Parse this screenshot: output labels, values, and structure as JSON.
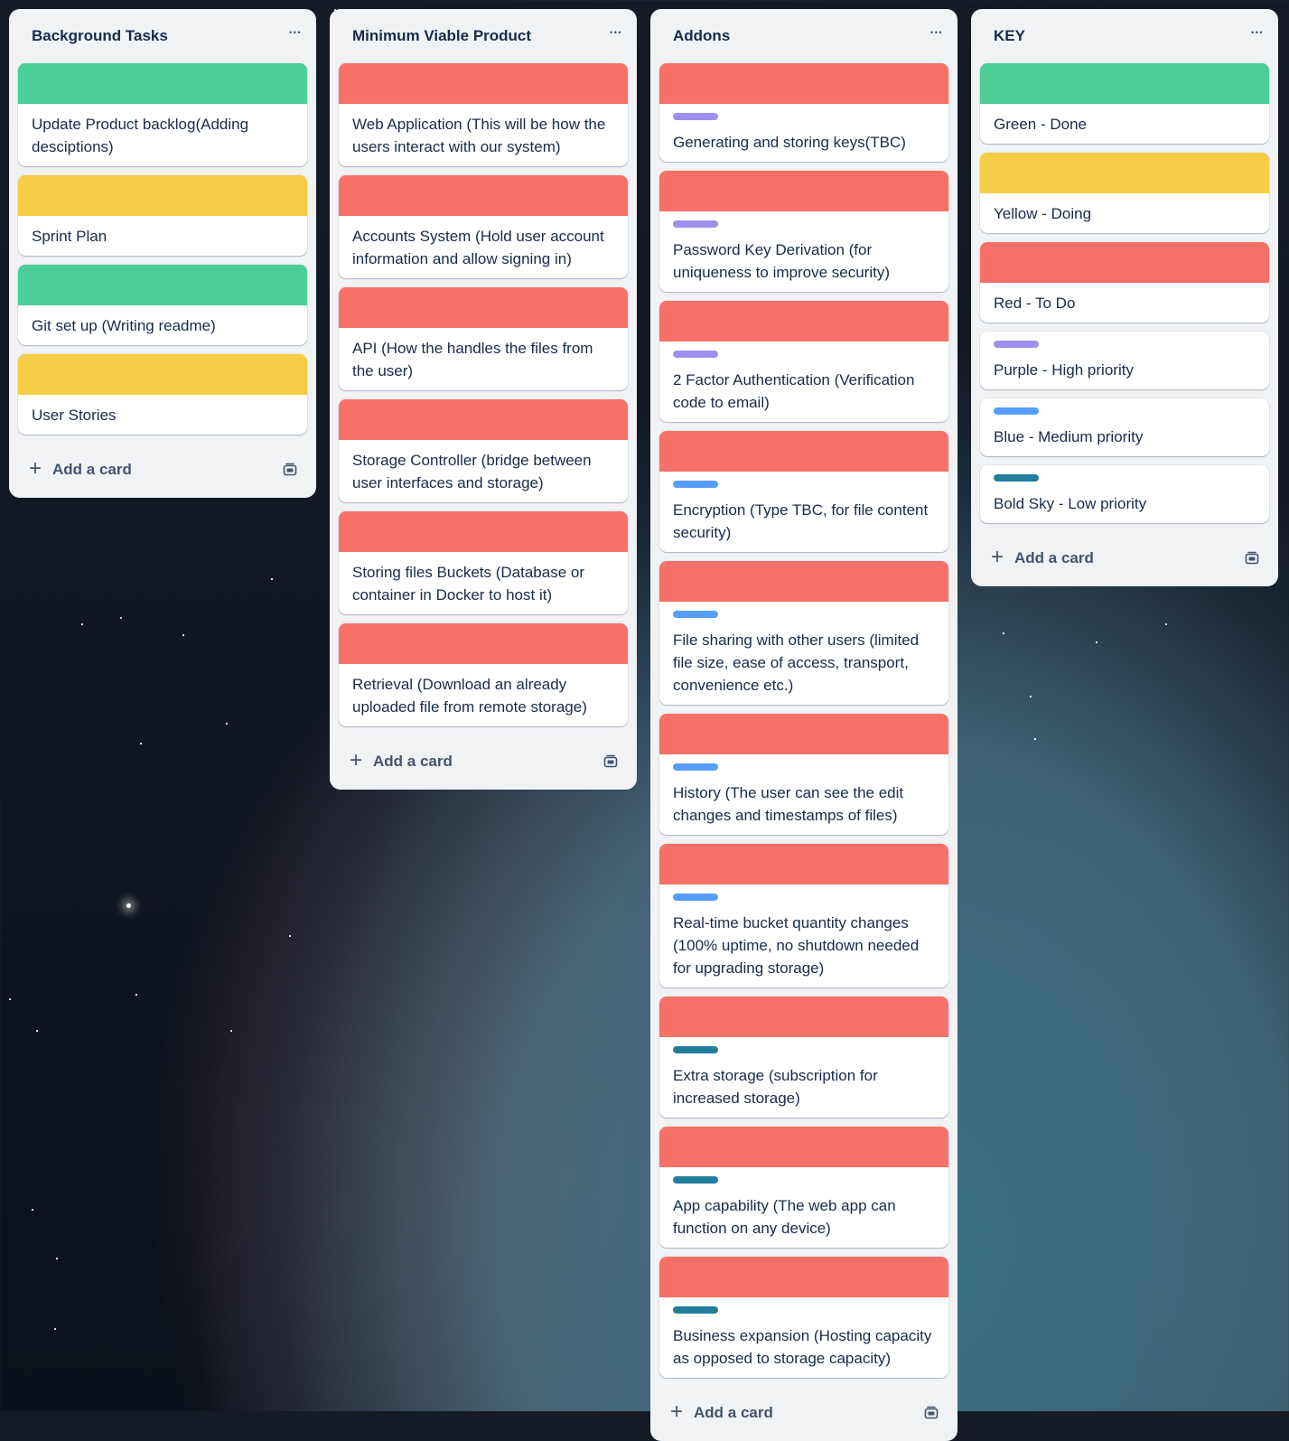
{
  "colors": {
    "green": "#4bce97",
    "yellow": "#f5cd47",
    "red": "#f87168",
    "purple": "#9f8fef",
    "blue": "#579dff",
    "bold_sky": "#227d9b"
  },
  "lists": [
    {
      "title": "Background Tasks",
      "menu_icon": "more-icon",
      "add_card_label": "Add a card",
      "cards": [
        {
          "cover": "green",
          "label": null,
          "title": "Update Product backlog(Adding desciptions)"
        },
        {
          "cover": "yellow",
          "label": null,
          "title": "Sprint Plan"
        },
        {
          "cover": "green",
          "label": null,
          "title": "Git set up (Writing readme)"
        },
        {
          "cover": "yellow",
          "label": null,
          "title": "User Stories"
        }
      ]
    },
    {
      "title": "Minimum Viable Product",
      "menu_icon": "more-icon",
      "add_card_label": "Add a card",
      "cards": [
        {
          "cover": "red",
          "label": null,
          "title": "Web Application (This will be how the users interact with our system)"
        },
        {
          "cover": "red",
          "label": null,
          "title": "Accounts System (Hold user account information and allow signing in)"
        },
        {
          "cover": "red",
          "label": null,
          "title": "API (How the handles the files from the user)"
        },
        {
          "cover": "red",
          "label": null,
          "title": "Storage Controller (bridge between user interfaces and storage)"
        },
        {
          "cover": "red",
          "label": null,
          "title": "Storing files Buckets (Database or container in Docker to host it)"
        },
        {
          "cover": "red",
          "label": null,
          "title": "Retrieval (Download an already uploaded file from remote storage)"
        }
      ]
    },
    {
      "title": "Addons",
      "menu_icon": "more-icon",
      "add_card_label": "Add a card",
      "cards": [
        {
          "cover": "red",
          "label": "purple",
          "title": "Generating and storing keys(TBC)"
        },
        {
          "cover": "red",
          "label": "purple",
          "title": "Password Key Derivation (for uniqueness to improve security)"
        },
        {
          "cover": "red",
          "label": "purple",
          "title": "2 Factor Authentication (Verification code to email)"
        },
        {
          "cover": "red",
          "label": "blue",
          "title": "Encryption (Type TBC, for file content security)"
        },
        {
          "cover": "red",
          "label": "blue",
          "title": "File sharing with other users (limited file size, ease of access, transport, convenience etc.)"
        },
        {
          "cover": "red",
          "label": "blue",
          "title": "History (The user can see the edit changes and timestamps of files)"
        },
        {
          "cover": "red",
          "label": "blue",
          "title": "Real-time bucket quantity changes (100% uptime, no shutdown needed for upgrading storage)"
        },
        {
          "cover": "red",
          "label": "bold_sky",
          "title": "Extra storage (subscription for increased storage)"
        },
        {
          "cover": "red",
          "label": "bold_sky",
          "title": "App capability (The web app can function on any device)"
        },
        {
          "cover": "red",
          "label": "bold_sky",
          "title": "Business expansion (Hosting capacity as opposed to storage capacity)"
        }
      ]
    },
    {
      "title": "KEY",
      "menu_icon": "more-icon",
      "add_card_label": "Add a card",
      "cards": [
        {
          "cover": "green",
          "label": null,
          "title": "Green - Done"
        },
        {
          "cover": "yellow",
          "label": null,
          "title": "Yellow - Doing"
        },
        {
          "cover": "red",
          "label": null,
          "title": "Red - To Do"
        },
        {
          "cover": null,
          "label": "purple",
          "title": "Purple - High priority"
        },
        {
          "cover": null,
          "label": "blue",
          "title": "Blue - Medium priority"
        },
        {
          "cover": null,
          "label": "bold_sky",
          "title": "Bold Sky - Low priority"
        }
      ]
    }
  ]
}
